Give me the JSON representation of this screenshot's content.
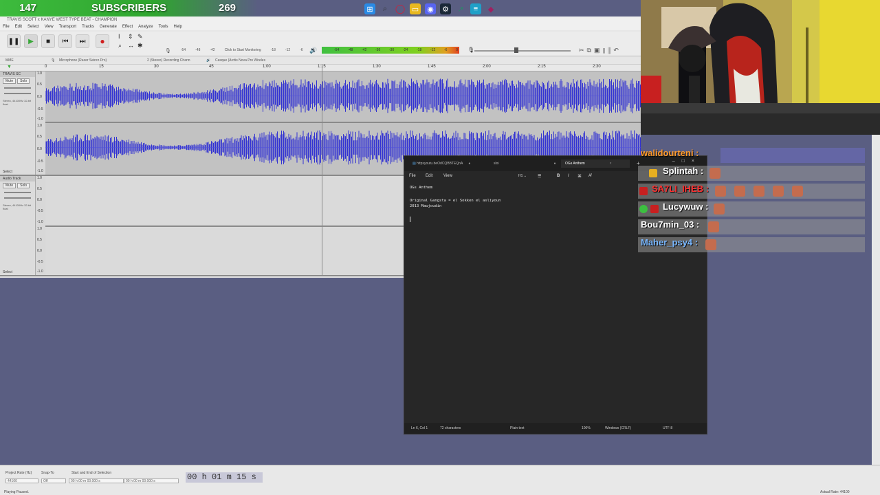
{
  "overlay": {
    "left_count": "147",
    "label": "SUBSCRIBERS",
    "right_count": "269"
  },
  "taskbar": {
    "icons": [
      "windows-icon",
      "search-icon",
      "opera-gx-icon",
      "file-explorer-icon",
      "discord-icon",
      "steam-icon",
      "app-icon",
      "notepad-icon",
      "app-icon-2"
    ]
  },
  "audacity": {
    "title": "TRAVIS SCOTT x KANYE WEST TYPE BEAT - CHAMPION",
    "menu": [
      "File",
      "Edit",
      "Select",
      "View",
      "Transport",
      "Tracks",
      "Generate",
      "Effect",
      "Analyze",
      "Tools",
      "Help"
    ],
    "meter_label": "Click to Start Monitoring",
    "meter_ticks": [
      "-54",
      "-48",
      "-42",
      "-18",
      "-12",
      "-6",
      "0"
    ],
    "play_meter_ticks": [
      "-54",
      "-48",
      "-42",
      "-36",
      "-30",
      "-24",
      "-18",
      "-12",
      "-6",
      "0"
    ],
    "device": {
      "host": "MME",
      "mic": "Microphone (Razer Seiren Pro)",
      "channels": "2 (Stereo) Recording Chann",
      "output": "Casque (Arctis Nova Pro Wireles"
    },
    "timeline": [
      "0",
      "15",
      "30",
      "45",
      "1:00",
      "1:15",
      "1:30",
      "1:45",
      "2:00",
      "2:15",
      "2:30"
    ],
    "tracks": [
      {
        "name": "TRAVIS SC",
        "mute": "Mute",
        "solo": "Solo",
        "info": "Stereo, 44100Hz 32-bit float",
        "select": "Select",
        "scale": [
          "1.0",
          "0.5",
          "0.0",
          "-0.5",
          "-1.0"
        ]
      },
      {
        "name": "Audio Track",
        "mute": "Mute",
        "solo": "Solo",
        "info": "Stereo, 44100Hz 32-bit float",
        "select": "Select",
        "scale": [
          "1.0",
          "0.5",
          "0.0",
          "-0.5",
          "-1.0"
        ]
      }
    ],
    "status": {
      "project_rate_label": "Project Rate (Hz)",
      "project_rate": "44100",
      "snap_label": "Snap-To",
      "snap_value": "Off",
      "selection_label": "Start and End of Selection",
      "sel_start": "00 h 00 m 00.000 s",
      "sel_end": "00 h 00 m 00.000 s",
      "time": "00 h 01 m 15 s",
      "playing": "Playing Paused.",
      "actual_rate": "Actual Rate: 44100"
    }
  },
  "notepad": {
    "tabs": [
      {
        "label": "httpsyoutu.beOdCQBBTEQnA",
        "active": false
      },
      {
        "label": "sloi",
        "active": false
      },
      {
        "label": "OGs Anthem",
        "active": true
      }
    ],
    "menu": [
      "File",
      "Edit",
      "View"
    ],
    "lines": [
      "OGs Anthem",
      "",
      "Original Gangsta = el Sokken el asliyoun",
      "2013 Mawjoudin",
      "",
      ""
    ],
    "status": {
      "position": "Ln 6, Col 1",
      "chars": "72 characters",
      "format": "Plain text",
      "zoom": "100%",
      "eol": "Windows (CRLF)",
      "encoding": "UTF-8"
    }
  },
  "chat": [
    {
      "user": "walidourteni :",
      "color": "#ff9a2a"
    },
    {
      "user": "Splintah :",
      "color": "#ffffff"
    },
    {
      "user": "SA7LI_IHEB :",
      "color": "#ff3030"
    },
    {
      "user": "Lucywuw :",
      "color": "#ffffff"
    },
    {
      "user": "Bou7min_03 :",
      "color": "#ffffff"
    },
    {
      "user": "Maher_psy4 :",
      "color": "#7ab8ff"
    }
  ]
}
